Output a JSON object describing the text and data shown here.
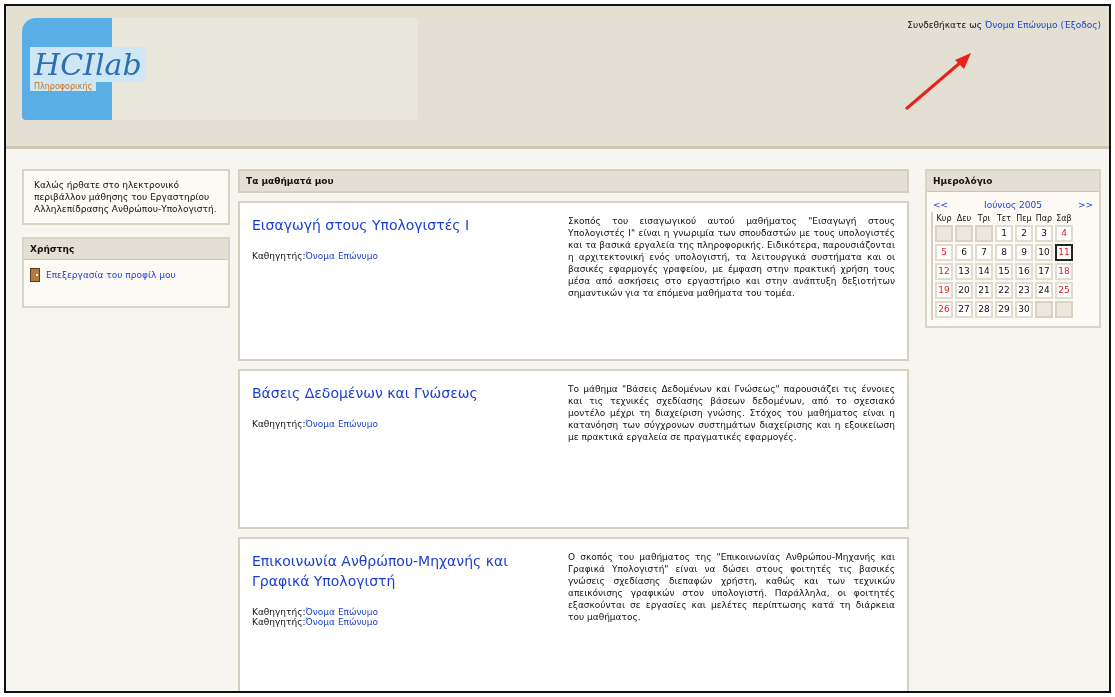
{
  "header": {
    "logo": "HCIlab",
    "logo_subtitle": "Πληροφορικής",
    "login_text": "Συνδεθήκατε ως",
    "user_link": "Όνομα Επώνυμο",
    "logout_link": "(Έξοδος)"
  },
  "intro_block": {
    "text": "Καλώς ήρθατε στο ηλεκτρονικό περιβάλλον μάθησης του Εργαστηρίου Αλληλεπίδρασης Ανθρώπου-Υπολογιστή."
  },
  "user_block": {
    "title": "Χρήστης",
    "items": [
      {
        "label": "Επεξεργασία του προφίλ μου"
      }
    ]
  },
  "courses_block": {
    "title": "Τα μαθήματά μου",
    "courses": [
      {
        "title": "Εισαγωγή στους Υπολογιστές Ι",
        "teachers": [
          {
            "role": "Καθηγητής:",
            "name": "Όνομα Επώνυμο"
          }
        ],
        "summary": "Σκοπός του εισαγωγικού αυτού μαθήματος \"Εισαγωγή στους Υπολογιστές Ι\" είναι η γνωριμία των σπουδαστών με τους υπολογιστές και τα βασικά εργαλεία της πληροφορικής. Ειδικότερα, παρουσιάζονται η αρχιτεκτονική ενός υπολογιστή, τα λειτουργικά συστήματα και οι βασικές εφαρμογές γραφείου, με έμφαση στην πρακτική χρήση τους μέσα από ασκήσεις στο εργαστήριο και στην ανάπτυξη δεξιοτήτων σημαντικών για τα επόμενα μαθήματα του τομέα."
      },
      {
        "title": "Βάσεις Δεδομένων και Γνώσεως",
        "teachers": [
          {
            "role": "Καθηγητής:",
            "name": "Όνομα Επώνυμο"
          }
        ],
        "summary": "Το μάθημα \"Βάσεις Δεδομένων και Γνώσεως\" παρουσιάζει τις έννοιες και τις τεχνικές σχεδίασης βάσεων δεδομένων, από το σχεσιακό μοντέλο μέχρι τη διαχείριση γνώσης. Στόχος του μαθήματος είναι η κατανόηση των σύγχρονων συστημάτων διαχείρισης και η εξοικείωση με πρακτικά εργαλεία σε πραγματικές εφαρμογές."
      },
      {
        "title": "Επικοινωνία Ανθρώπου-Μηχανής και Γραφικά Υπολογιστή",
        "teachers": [
          {
            "role": "Καθηγητής:",
            "name": "Όνομα Επώνυμο"
          },
          {
            "role": "Καθηγητής:",
            "name": "Όνομα Επώνυμο"
          }
        ],
        "summary": "Ο σκοπός του μαθήματος της \"Επικοινωνίας Ανθρώπου-Μηχανής και Γραφικά Υπολογιστή\" είναι να δώσει στους φοιτητές τις βασικές γνώσεις σχεδίασης διεπαφών χρήστη, καθώς και των τεχνικών απεικόνισης γραφικών στον υπολογιστή. Παράλληλα, οι φοιτητές εξασκούνται σε εργασίες και μελέτες περίπτωσης κατά τη διάρκεια του μαθήματος."
      }
    ]
  },
  "calendar_block": {
    "title": "Ημερολόγιο",
    "prev": "<<",
    "month": "Ιούνιος 2005",
    "next": ">>",
    "weekdays": [
      "Κυρ",
      "Δευ",
      "Τρι",
      "Τετ",
      "Πεμ",
      "Παρ",
      "Σαβ"
    ],
    "weeks": [
      [
        {
          "kind": "blank"
        },
        {
          "kind": "blank"
        },
        {
          "kind": "blank"
        },
        {
          "day": "1",
          "weekend": false,
          "today": false
        },
        {
          "day": "2",
          "weekend": false,
          "today": false
        },
        {
          "day": "3",
          "weekend": false,
          "today": false
        },
        {
          "day": "4",
          "weekend": true,
          "today": false
        }
      ],
      [
        {
          "day": "5",
          "weekend": true,
          "today": false
        },
        {
          "day": "6",
          "weekend": false,
          "today": false
        },
        {
          "day": "7",
          "weekend": false,
          "today": false
        },
        {
          "day": "8",
          "weekend": false,
          "today": false
        },
        {
          "day": "9",
          "weekend": false,
          "today": false
        },
        {
          "day": "10",
          "weekend": false,
          "today": false
        },
        {
          "day": "11",
          "weekend": true,
          "today": true
        }
      ],
      [
        {
          "day": "12",
          "weekend": true,
          "today": false
        },
        {
          "day": "13",
          "weekend": false,
          "today": false
        },
        {
          "day": "14",
          "weekend": false,
          "today": false
        },
        {
          "day": "15",
          "weekend": false,
          "today": false
        },
        {
          "day": "16",
          "weekend": false,
          "today": false
        },
        {
          "day": "17",
          "weekend": false,
          "today": false
        },
        {
          "day": "18",
          "weekend": true,
          "today": false
        }
      ],
      [
        {
          "day": "19",
          "weekend": true,
          "today": false
        },
        {
          "day": "20",
          "weekend": false,
          "today": false
        },
        {
          "day": "21",
          "weekend": false,
          "today": false
        },
        {
          "day": "22",
          "weekend": false,
          "today": false
        },
        {
          "day": "23",
          "weekend": false,
          "today": false
        },
        {
          "day": "24",
          "weekend": false,
          "today": false
        },
        {
          "day": "25",
          "weekend": true,
          "today": false
        }
      ],
      [
        {
          "day": "26",
          "weekend": true,
          "today": false
        },
        {
          "day": "27",
          "weekend": false,
          "today": false
        },
        {
          "day": "28",
          "weekend": false,
          "today": false
        },
        {
          "day": "29",
          "weekend": false,
          "today": false
        },
        {
          "day": "30",
          "weekend": false,
          "today": false
        },
        {
          "kind": "blank"
        },
        {
          "kind": "blank"
        }
      ]
    ]
  }
}
